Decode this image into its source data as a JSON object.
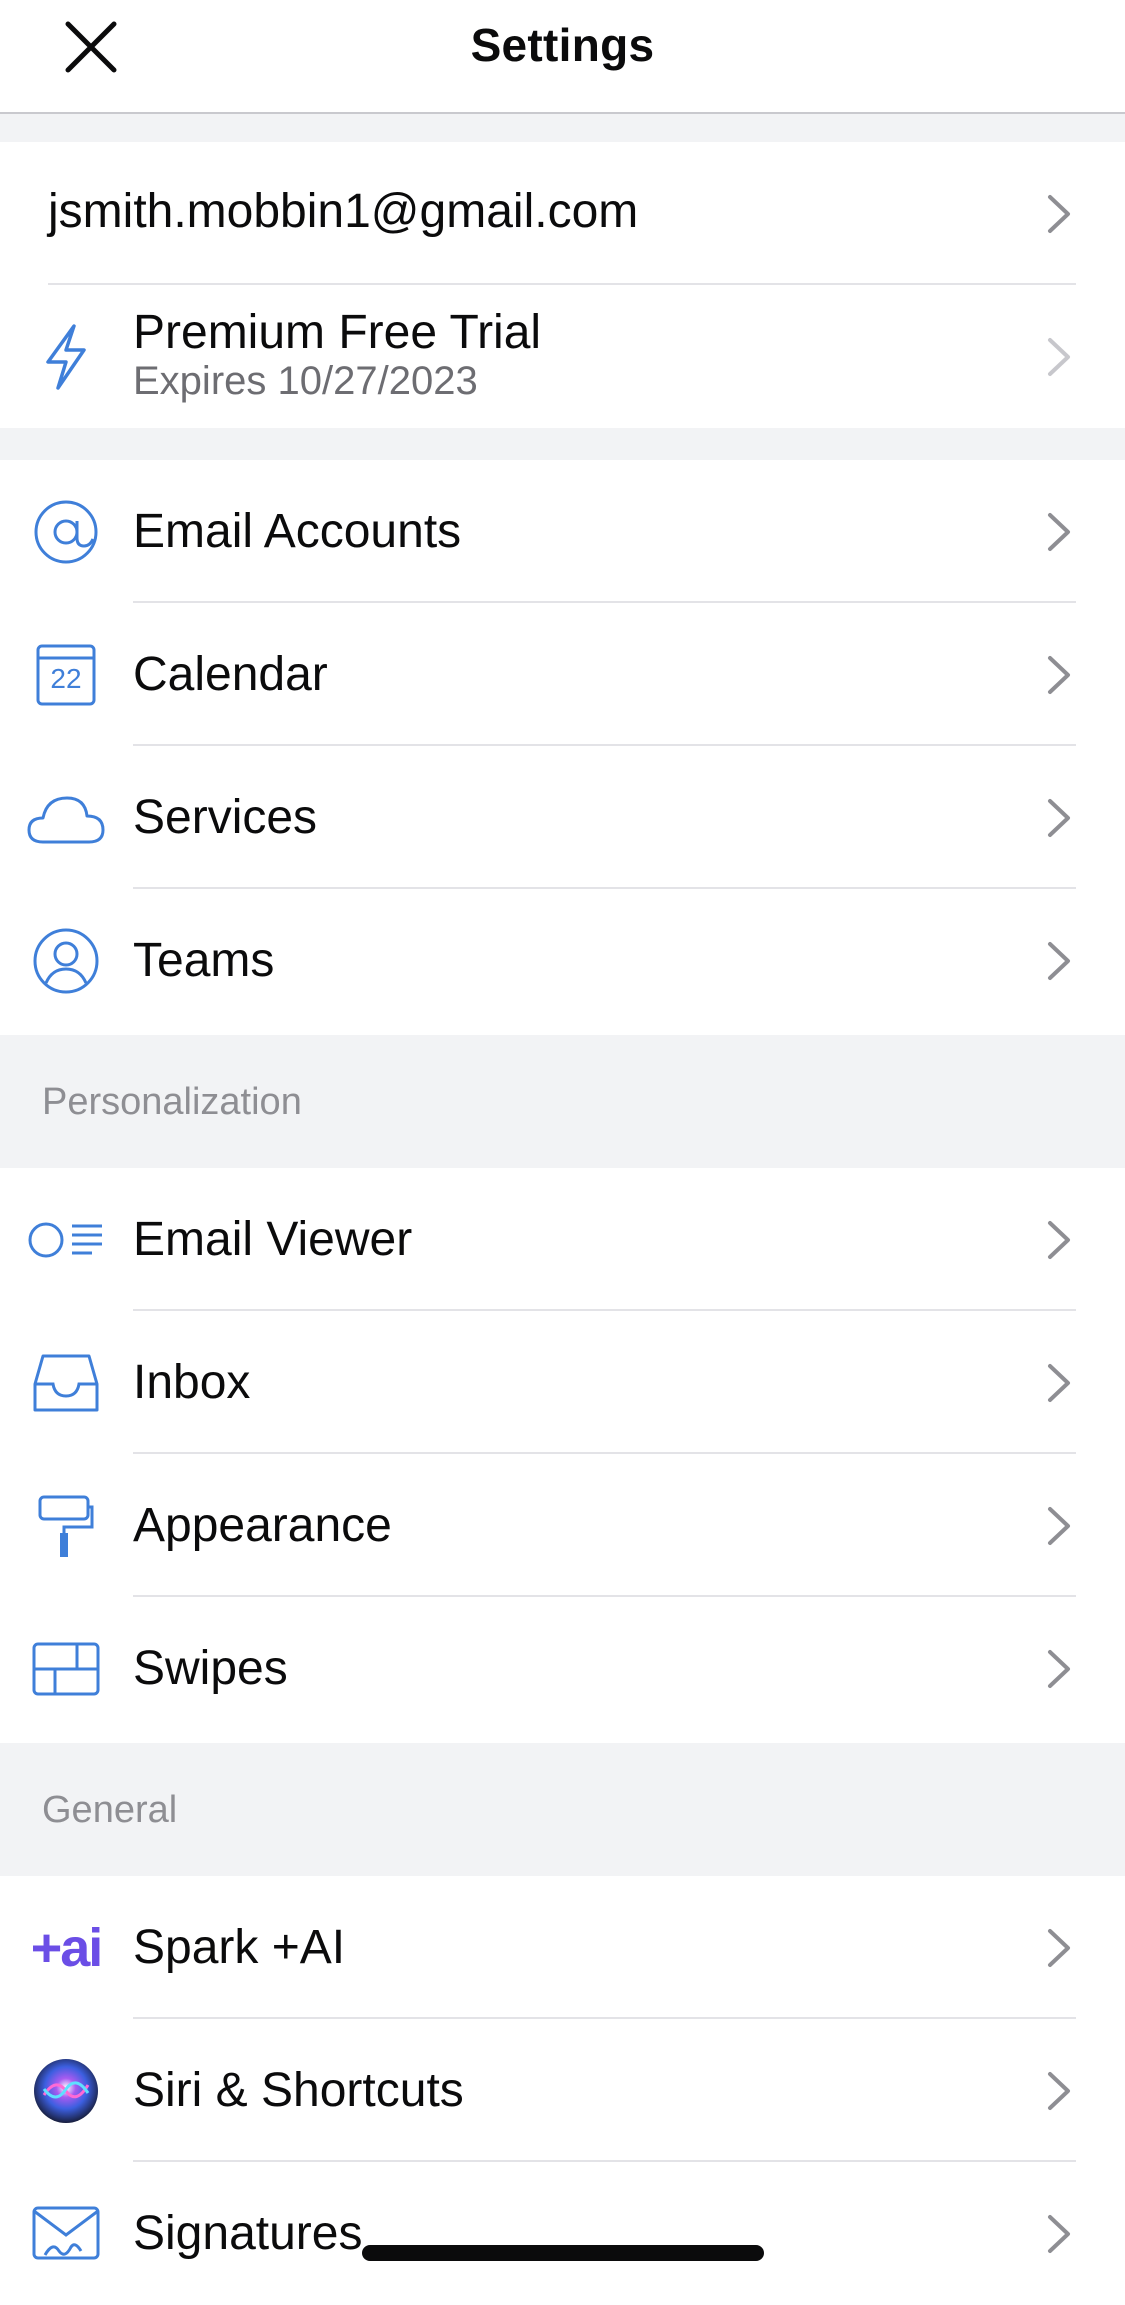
{
  "header": {
    "title": "Settings"
  },
  "account": {
    "email": "jsmith.mobbin1@gmail.com",
    "premium_title": "Premium Free Trial",
    "premium_subtitle": "Expires 10/27/2023"
  },
  "group1": [
    {
      "label": "Email Accounts",
      "icon": "at-sign-icon"
    },
    {
      "label": "Calendar",
      "icon": "calendar-icon",
      "icon_text": "22"
    },
    {
      "label": "Services",
      "icon": "cloud-icon"
    },
    {
      "label": "Teams",
      "icon": "person-circle-icon"
    }
  ],
  "personalization": {
    "header": "Personalization",
    "items": [
      {
        "label": "Email Viewer",
        "icon": "email-viewer-icon"
      },
      {
        "label": "Inbox",
        "icon": "inbox-tray-icon"
      },
      {
        "label": "Appearance",
        "icon": "paint-roller-icon"
      },
      {
        "label": "Swipes",
        "icon": "swipes-grid-icon"
      }
    ]
  },
  "general": {
    "header": "General",
    "items": [
      {
        "label": "Spark +AI",
        "icon": "spark-ai-icon",
        "icon_text": "+ai"
      },
      {
        "label": "Siri & Shortcuts",
        "icon": "siri-icon"
      },
      {
        "label": "Signatures",
        "icon": "signature-icon"
      }
    ]
  },
  "colors": {
    "accent": "#3f7fd9",
    "chevron": "#8e8e93",
    "group_bg": "#f2f3f5",
    "ai_purple": "#6b4ee6"
  }
}
